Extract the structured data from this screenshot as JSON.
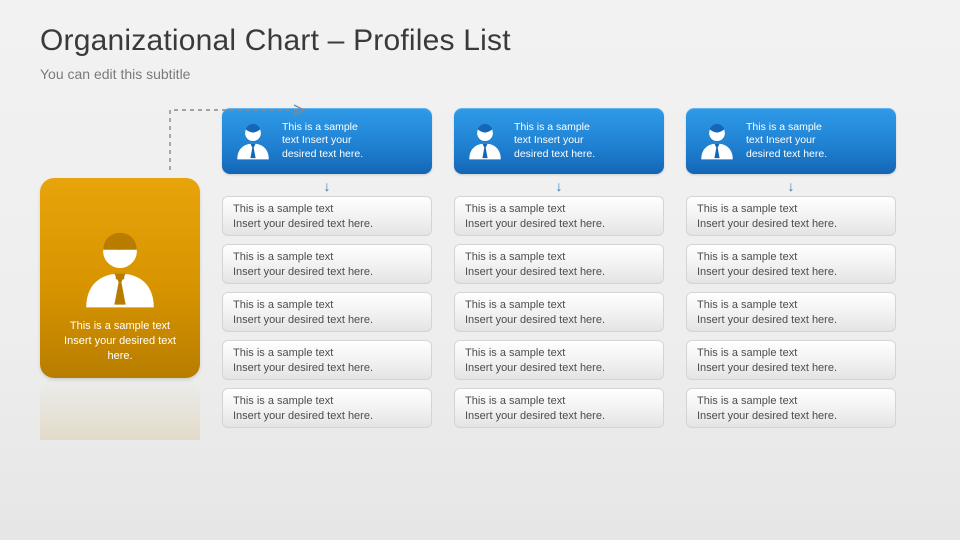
{
  "title": "Organizational Chart – Profiles List",
  "subtitle": "You can edit this subtitle",
  "lead": {
    "text": "This is a sample text\nInsert your desired text\nhere."
  },
  "columns": [
    {
      "header_text": "This is a sample\ntext Insert your\ndesired text here.",
      "items": [
        "This is a sample text\nInsert your desired text here.",
        "This is a sample text\nInsert your desired text here.",
        "This is a sample text\nInsert your desired text here.",
        "This is a sample text\nInsert your desired text here.",
        "This is a sample text\nInsert your desired text here."
      ]
    },
    {
      "header_text": "This is a sample\ntext Insert your\ndesired text here.",
      "items": [
        "This is a sample text\nInsert your desired text here.",
        "This is a sample text\nInsert your desired text here.",
        "This is a sample text\nInsert your desired text here.",
        "This is a sample text\nInsert your desired text here.",
        "This is a sample text\nInsert your desired text here."
      ]
    },
    {
      "header_text": "This is a sample\ntext Insert your\ndesired text here.",
      "items": [
        "This is a sample text\nInsert your desired text here.",
        "This is a sample text\nInsert your desired text here.",
        "This is a sample text\nInsert your desired text here.",
        "This is a sample text\nInsert your desired text here.",
        "This is a sample text\nInsert your desired text here."
      ]
    }
  ],
  "icons": {
    "down_arrow": "↓"
  },
  "colors": {
    "accent_blue": "#1f7fd0",
    "accent_gold": "#d79400",
    "text_muted": "#7a7a7a"
  }
}
